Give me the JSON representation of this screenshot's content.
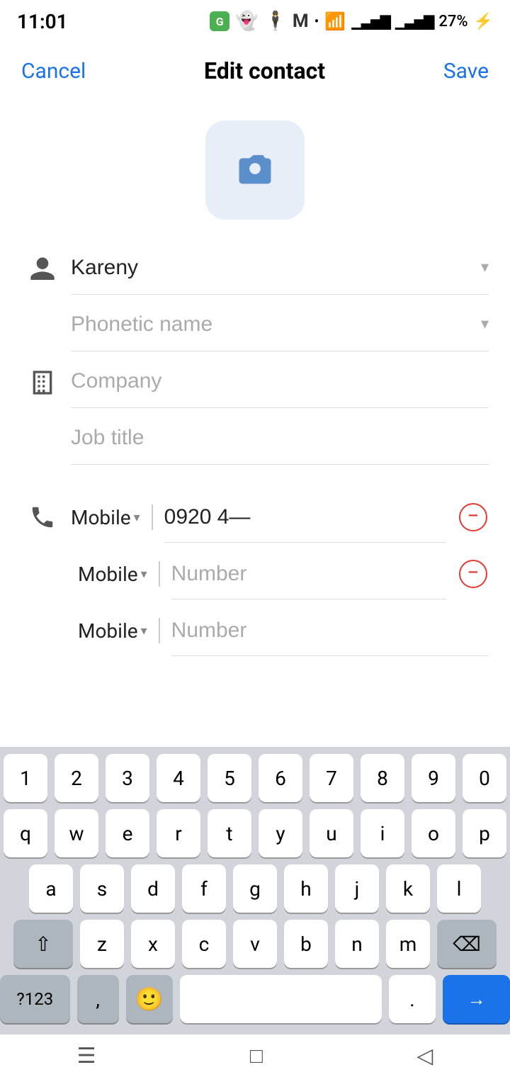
{
  "status": {
    "time": "11:01",
    "battery": "27%",
    "wifi_icon": "wifi",
    "signal_icon": "signal"
  },
  "header": {
    "cancel_label": "Cancel",
    "title": "Edit contact",
    "save_label": "Save"
  },
  "avatar": {
    "camera_label": "camera"
  },
  "form": {
    "name_value": "Kareny",
    "name_placeholder": "",
    "phonetic_placeholder": "Phonetic name",
    "company_placeholder": "Company",
    "job_title_placeholder": "Job title"
  },
  "phones": [
    {
      "type": "Mobile",
      "value": "0920 4—",
      "placeholder": "",
      "removable": true
    },
    {
      "type": "Mobile",
      "value": "",
      "placeholder": "Number",
      "removable": true
    },
    {
      "type": "Mobile",
      "value": "",
      "placeholder": "Number",
      "removable": false
    }
  ],
  "keyboard": {
    "row1": [
      "1",
      "2",
      "3",
      "4",
      "5",
      "6",
      "7",
      "8",
      "9",
      "0"
    ],
    "row2": [
      "q",
      "w",
      "e",
      "r",
      "t",
      "y",
      "u",
      "i",
      "o",
      "p"
    ],
    "row3": [
      "a",
      "s",
      "d",
      "f",
      "g",
      "h",
      "j",
      "k",
      "l"
    ],
    "row4": [
      "z",
      "x",
      "c",
      "v",
      "b",
      "n",
      "m"
    ],
    "special_123": "?123",
    "comma": ",",
    "period": ".",
    "enter_icon": "→",
    "shift_icon": "⇧",
    "backspace_icon": "⌫"
  },
  "navbar": {
    "menu_icon": "☰",
    "home_icon": "□",
    "back_icon": "◁"
  }
}
